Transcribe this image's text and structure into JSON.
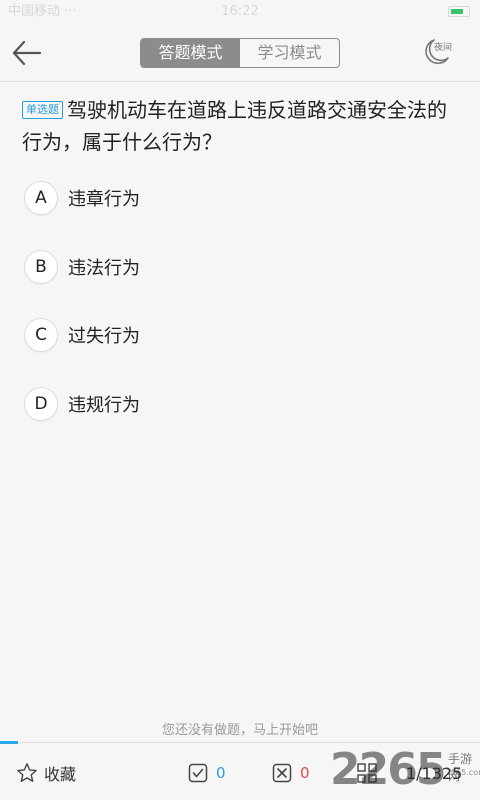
{
  "status_bar": {
    "carrier": "中国移动 ···",
    "time": "16:22"
  },
  "header": {
    "tabs": [
      {
        "label": "答题模式",
        "active": true
      },
      {
        "label": "学习模式",
        "active": false
      }
    ],
    "night_label": "夜间"
  },
  "question": {
    "type": "单选题",
    "text": "驾驶机动车在道路上违反道路交通安全法的行为，属于什么行为？"
  },
  "options": [
    {
      "letter": "A",
      "text": "违章行为"
    },
    {
      "letter": "B",
      "text": "违法行为"
    },
    {
      "letter": "C",
      "text": "过失行为"
    },
    {
      "letter": "D",
      "text": "违规行为"
    }
  ],
  "hint": "您还没有做题，马上开始吧",
  "bottom_bar": {
    "favorite_label": "收藏",
    "correct_count": "0",
    "wrong_count": "0",
    "progress": "1/1325"
  },
  "watermark": {
    "digits": "2265",
    "sub": "手游网",
    "url": "2265.com"
  },
  "colors": {
    "accent": "#2b9edb",
    "wrong": "#e04848",
    "mode_tab": "#8c8c8c"
  },
  "icons": {
    "back": "arrow-left-icon",
    "night": "moon-icon",
    "favorite": "star-icon",
    "correct": "check-box-icon",
    "wrong": "x-box-icon",
    "grid": "grid-icon"
  }
}
